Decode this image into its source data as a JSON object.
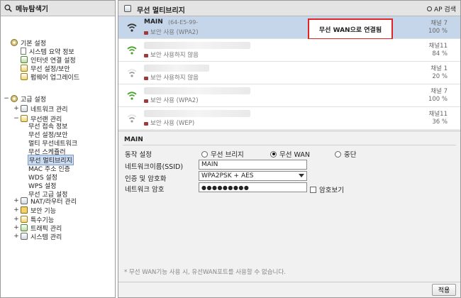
{
  "left_panel": {
    "title": "메뉴탐색기",
    "tree": [
      {
        "label": "기본 설정",
        "level": 0,
        "icon": "gear-icon"
      },
      {
        "label": "시스템 요약 정보",
        "level": 1,
        "icon": "doc-icon"
      },
      {
        "label": "인터넷 연결 설정",
        "level": 1,
        "icon": "globe-icon"
      },
      {
        "label": "무선 설정/보안",
        "level": 1,
        "icon": "wireless-icon"
      },
      {
        "label": "펌웨어 업그레이드",
        "level": 1,
        "icon": "upgrade-icon"
      },
      {
        "label": "고급 설정",
        "level": 0,
        "expander": "−",
        "icon": "gear-icon"
      },
      {
        "label": "네트워크 관리",
        "level": 1,
        "expander": "+",
        "icon": "network-icon"
      },
      {
        "label": "무선랜 관리",
        "level": 1,
        "expander": "−",
        "icon": "wireless-icon"
      },
      {
        "label": "무선 접속 정보",
        "level": 2,
        "icon": "doc-icon"
      },
      {
        "label": "무선 설정/보안",
        "level": 2,
        "icon": "doc-icon"
      },
      {
        "label": "멀티 무선네트워크",
        "level": 2,
        "icon": "doc-icon"
      },
      {
        "label": "무선 스케쥴러",
        "level": 2,
        "icon": "doc-icon"
      },
      {
        "label": "무선 멀티브리지",
        "level": 2,
        "icon": "doc-icon",
        "selected": true
      },
      {
        "label": "MAC 주소 인증",
        "level": 2,
        "icon": "doc-icon"
      },
      {
        "label": "WDS 설정",
        "level": 2,
        "icon": "doc-icon"
      },
      {
        "label": "WPS 설정",
        "level": 2,
        "icon": "doc-icon"
      },
      {
        "label": "무선 고급 설정",
        "level": 2,
        "icon": "doc-icon"
      },
      {
        "label": "NAT/라우터 관리",
        "level": 1,
        "expander": "+",
        "icon": "router-icon"
      },
      {
        "label": "보안 기능",
        "level": 1,
        "expander": "+",
        "icon": "lock-icon"
      },
      {
        "label": "특수기능",
        "level": 1,
        "expander": "+",
        "icon": "special-icon"
      },
      {
        "label": "트래픽 관리",
        "level": 1,
        "expander": "+",
        "icon": "traffic-icon"
      },
      {
        "label": "시스템 관리",
        "level": 1,
        "expander": "+",
        "icon": "system-icon"
      }
    ]
  },
  "right_panel": {
    "title": "무선 멀티브리지",
    "search_label": "AP 검색",
    "ap_list": [
      {
        "ssid": "MAIN",
        "mac": "(64-E5-99-",
        "security": "보안 사용 (WPA2)",
        "channel": "채널 7",
        "signal": "100 %",
        "signal_level": 1.0,
        "selected": true,
        "status": "무선 WAN으로 연결됨",
        "wifi_color": "#333333"
      },
      {
        "ssid": "",
        "mac": "",
        "security": "보안 사용하지 않음",
        "channel": "채널11",
        "signal": "84 %",
        "signal_level": 0.84,
        "wifi_color": "#4aa02c"
      },
      {
        "ssid": "",
        "mac": "",
        "security": "보안 사용하지 않음",
        "channel": "채널 1",
        "signal": "20 %",
        "signal_level": 0.2,
        "wifi_color": "#9a9a9a"
      },
      {
        "ssid": "",
        "mac": "",
        "security": "보안 사용 (WPA2)",
        "channel": "채널 7",
        "signal": "100 %",
        "signal_level": 1.0,
        "wifi_color": "#4aa02c"
      },
      {
        "ssid": "",
        "mac": "",
        "security": "보안 사용 (WEP)",
        "channel": "채널11",
        "signal": "36 %",
        "signal_level": 0.36,
        "wifi_color": "#9a9a9a"
      }
    ],
    "settings": {
      "section_title": "MAIN",
      "mode_label": "동작 설정",
      "mode_options": [
        "무선 브리지",
        "무선 WAN",
        "중단"
      ],
      "mode_selected": "무선 WAN",
      "ssid_label": "네트워크이름(SSID)",
      "ssid_value": "MAIN",
      "auth_label": "인증 및 암호화",
      "auth_value": "WPA2PSK + AES",
      "password_label": "네트워크 암호",
      "password_value": "●●●●●●●●●",
      "show_password_label": "암호보기",
      "note": "* 무선 WAN기능 사용 시, 유선WAN포트를 사용할 수 없습니다."
    },
    "apply_label": "적용"
  }
}
